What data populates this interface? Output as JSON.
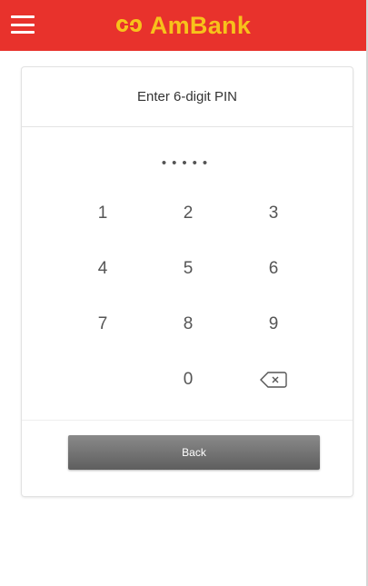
{
  "header": {
    "brand_name": "AmBank",
    "brand_color": "#f7c21b",
    "bar_color": "#e8322c",
    "menu_icon": "hamburger-menu-icon",
    "logo_icon": "ambank-logo-icon"
  },
  "pin_screen": {
    "title": "Enter 6-digit PIN",
    "pin_mask": "•••••",
    "keys": [
      "1",
      "2",
      "3",
      "4",
      "5",
      "6",
      "7",
      "8",
      "9",
      "",
      "0",
      "⌫"
    ],
    "back_label": "Back",
    "backspace_icon": "backspace-icon"
  }
}
